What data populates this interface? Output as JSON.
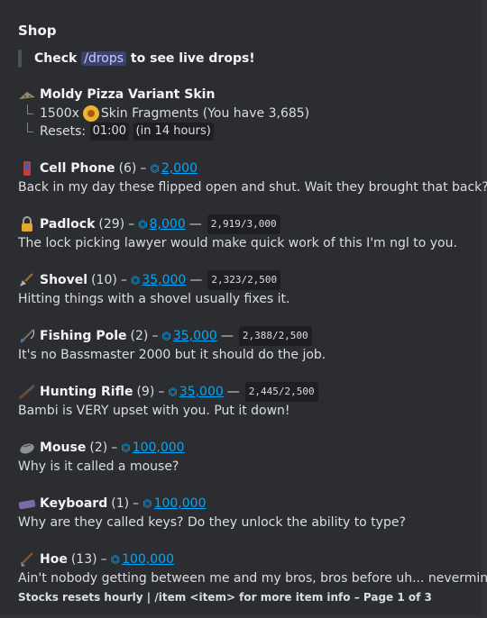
{
  "embed": {
    "title": "Shop",
    "notice": {
      "prefix": "Check",
      "command": "/drops",
      "suffix": "to see live drops!"
    },
    "featured": {
      "name": "Moldy Pizza Variant Skin",
      "cost_amount": "1500x",
      "cost_label": "Skin Fragments (You have 3,685)",
      "resets_label": "Resets:",
      "resets_time": "01:00",
      "resets_relative": "in 14 hours"
    },
    "items": [
      {
        "name": "Cell Phone",
        "qty": "(6)",
        "price": "2,000",
        "stock": "",
        "desc": "Back in my day these flipped open and shut. Wait they brought that back?",
        "icon": "cell-phone-icon"
      },
      {
        "name": "Padlock",
        "qty": "(29)",
        "price": "8,000",
        "stock": "2,919/3,000",
        "desc": "The lock picking lawyer would make quick work of this I'm ngl to you.",
        "icon": "padlock-icon"
      },
      {
        "name": "Shovel",
        "qty": "(10)",
        "price": "35,000",
        "stock": "2,323/2,500",
        "desc": "Hitting things with a shovel usually fixes it.",
        "icon": "shovel-icon"
      },
      {
        "name": "Fishing Pole",
        "qty": "(2)",
        "price": "35,000",
        "stock": "2,388/2,500",
        "desc": "It's no Bassmaster 2000 but it should do the job.",
        "icon": "fishing-pole-icon"
      },
      {
        "name": "Hunting Rifle",
        "qty": "(9)",
        "price": "35,000",
        "stock": "2,445/2,500",
        "desc": "Bambi is VERY upset with you. Put it down!",
        "icon": "hunting-rifle-icon"
      },
      {
        "name": "Mouse",
        "qty": "(2)",
        "price": "100,000",
        "stock": "",
        "desc": "Why is it called a mouse?",
        "icon": "mouse-icon"
      },
      {
        "name": "Keyboard",
        "qty": "(1)",
        "price": "100,000",
        "stock": "",
        "desc": "Why are they called keys? Do they unlock the ability to type?",
        "icon": "keyboard-icon"
      },
      {
        "name": "Hoe",
        "qty": "(13)",
        "price": "100,000",
        "stock": "",
        "desc": "Ain't nobody getting between me and my bros, bros before uh... nevermind.",
        "icon": "hoe-icon"
      }
    ],
    "footer": "Stocks resets hourly | /item <item> for more item info – Page 1 of 3",
    "colors": {
      "embed_bg": "#2b2d31",
      "link": "#00a8fc",
      "code_bg": "#1e1f22"
    }
  }
}
